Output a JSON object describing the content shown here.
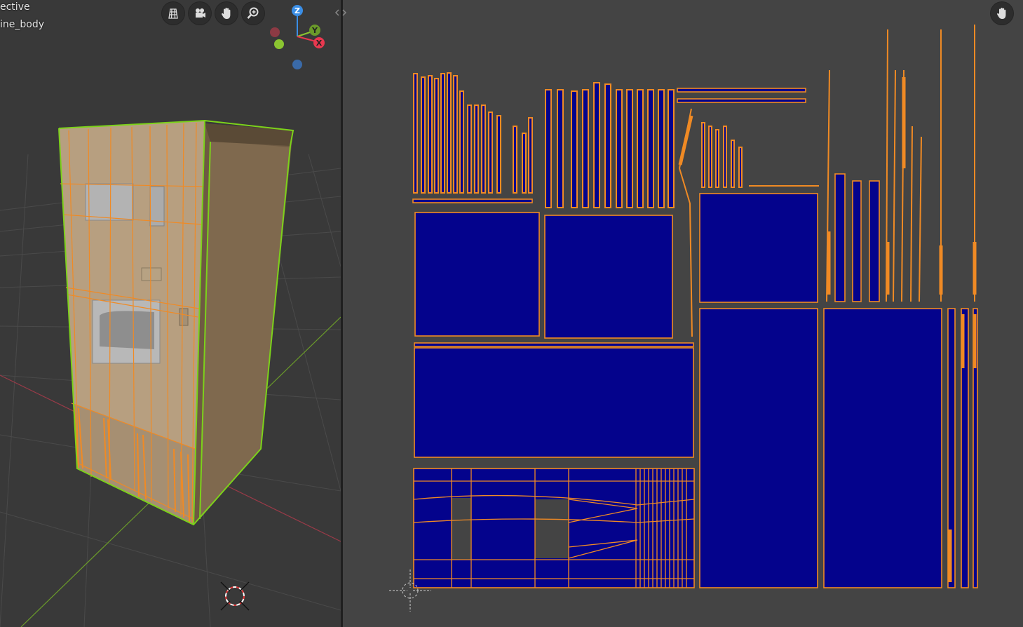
{
  "viewport": {
    "view_label": "ective",
    "object_label": "ine_body",
    "gizmo": {
      "z": "Z",
      "y": "Y",
      "x": "X"
    },
    "nav_buttons": [
      "grid-icon",
      "camera-icon",
      "hand-icon",
      "zoom-icon"
    ]
  },
  "uv_editor": {
    "nav_buttons": [
      "hand-icon"
    ]
  },
  "colors": {
    "uv_face": "#04038c",
    "uv_edge": "#f08a24",
    "selected_edge": "#7cd21a",
    "background": "#444444",
    "axis_x": "#e8384f",
    "axis_y": "#8bc531",
    "axis_z": "#3a8ee6"
  }
}
